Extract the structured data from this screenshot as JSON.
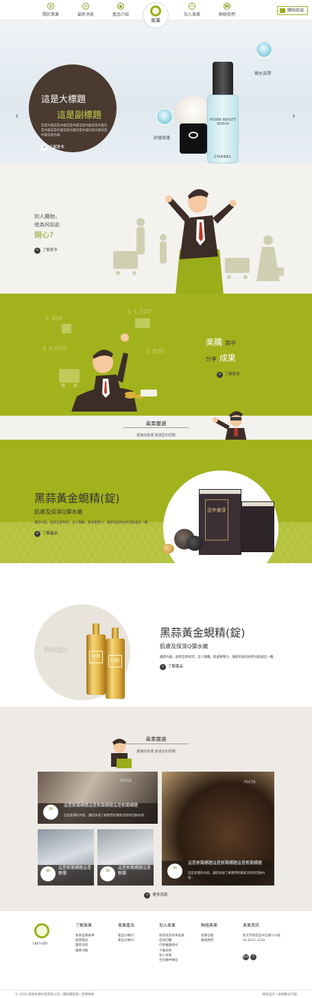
{
  "nav": {
    "items_left": [
      "關於楽果",
      "最新消息",
      "產品介紹"
    ],
    "items_right": [
      "加入楽果",
      "聯絡我們"
    ],
    "logo_text": "楽果",
    "cart": "購物商城",
    "accent": "#9aad1a"
  },
  "hero": {
    "title": "這是大標題",
    "subtitle": "這是副標題",
    "body": "這是內容這是內容這是內容這是內容這是內容這是內容這是內容這是內容這是內容這是內容這是內容這是內容",
    "more": "了解更多",
    "badge_right": "補水滋潤",
    "badge_left": "舒緩修護",
    "bottle_label": "HYDRA BEAUTY SERUM",
    "bottle_brand": "CHANEL",
    "slides": 3,
    "active_slide": 1
  },
  "happy": {
    "q1": "別人購物，",
    "q2": "他為何如此",
    "accent": "開心?",
    "more": "了解更多"
  },
  "share": {
    "money": [
      "$ 300",
      "$ 1,500",
      "$ 8,000",
      "$ 800"
    ],
    "t1_big": "楽購",
    "t1_small": "其中",
    "t2_small": "分享",
    "t2_big": "成果",
    "more": "了解更多"
  },
  "strip": {
    "title": "楽果嚴選",
    "sub": "嚴格的挑選 最滿足的把關"
  },
  "product1": {
    "title": "黑蒜黃金蜆精(錠)",
    "sub": "肌膚及保濕Q彈水嫩",
    "desc": "優質內容，創新全新研究，全人關藥，肌膚重整力，讓新的創造抗老化肌膚這一種。",
    "more": "了解產品",
    "box_text": "百年麥芽"
  },
  "product2": {
    "title": "黑蒜黃金蜆精(錠)",
    "sub": "肌膚及保濕Q彈水嫩",
    "desc": "優質內容，創新全新研究，全人關藥，肌膚重整力，讓新的創造抗老化肌膚這一種。",
    "more": "了解產品",
    "placeholder": "暫時圖片"
  },
  "news": {
    "title": "楽果嚴選",
    "sub": "嚴格的挑選 最滿足的把關",
    "more": "更多消息",
    "cards": [
      {
        "date": "30",
        "headline": "這是新聞標題這是新聞標題這是新聞標題",
        "body": "這是新聞的內容，讓您快速了解我們的最新消息和活動內容..."
      },
      {
        "date": "30",
        "headline": "這是新聞標題這是新聞標題這是新聞標題",
        "body": "這是新聞的內容，讓您快速了解我們的最新消息和活動內容..."
      },
      {
        "date": "30",
        "headline": "這是新聞標題這是新聞",
        "body": ""
      },
      {
        "date": "30",
        "headline": "這是新聞標題這是新聞",
        "body": ""
      }
    ],
    "watermark": "PIXTA"
  },
  "footer": {
    "logo_text": "Let's GO",
    "cols": [
      {
        "h": "了解楽果",
        "items": [
          "楽果品牌故事",
          "經營理念",
          "最新消息",
          "優惠活動"
        ]
      },
      {
        "h": "楽果產品",
        "items": [
          "產品分類01",
          "產品分類02"
        ]
      },
      {
        "h": "加入楽果",
        "items": [
          "如何成為楽果會員",
          "成果回饋",
          "行銷推廣模式",
          "下載表格",
          "加入楽果",
          "合作夥伴專區"
        ]
      },
      {
        "h": "聯絡楽果",
        "items": [
          "客服信箱",
          "聯絡我們"
        ]
      },
      {
        "h": "楽果資訊",
        "items": [
          "新北市新莊區中正路110號",
          "02-8531 3330"
        ]
      }
    ],
    "social": [
      "G+",
      "f"
    ],
    "copyright": "© 2016 楽果生物科技有限公司 | 隱私權政策 | 使用條款",
    "credit": "網頁設計 | 楽果數位行銷"
  }
}
